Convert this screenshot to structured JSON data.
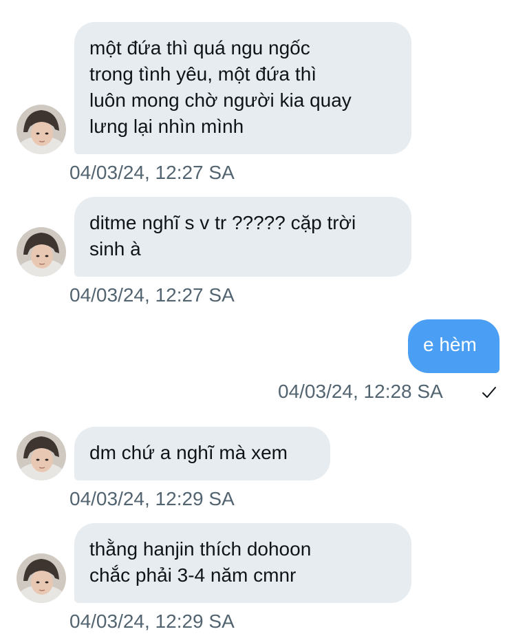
{
  "messages": [
    {
      "direction": "in",
      "text": "một đứa thì quá ngu ngốc\ntrong tình yêu, một đứa thì\nluôn mong chờ người kia quay\nlưng lại nhìn mình",
      "time": "04/03/24, 12:27 SA"
    },
    {
      "direction": "in",
      "text": "ditme nghĩ s v tr ????? cặp trời\nsinh à",
      "time": "04/03/24, 12:27 SA"
    },
    {
      "direction": "out",
      "text": "e hèm",
      "time": "04/03/24, 12:28 SA",
      "status_icon": "checkmark-icon"
    },
    {
      "direction": "in",
      "text": "dm chứ a nghĩ mà xem",
      "time": "04/03/24, 12:29 SA"
    },
    {
      "direction": "in",
      "text": "thằng hanjin thích dohoon\nchắc phải 3-4 năm cmnr",
      "time": "04/03/24, 12:29 SA"
    }
  ],
  "colors": {
    "incoming_bubble": "#e7ecf0",
    "outgoing_bubble": "#4a9ff5",
    "timestamp": "#536471",
    "text": "#0f1419"
  }
}
